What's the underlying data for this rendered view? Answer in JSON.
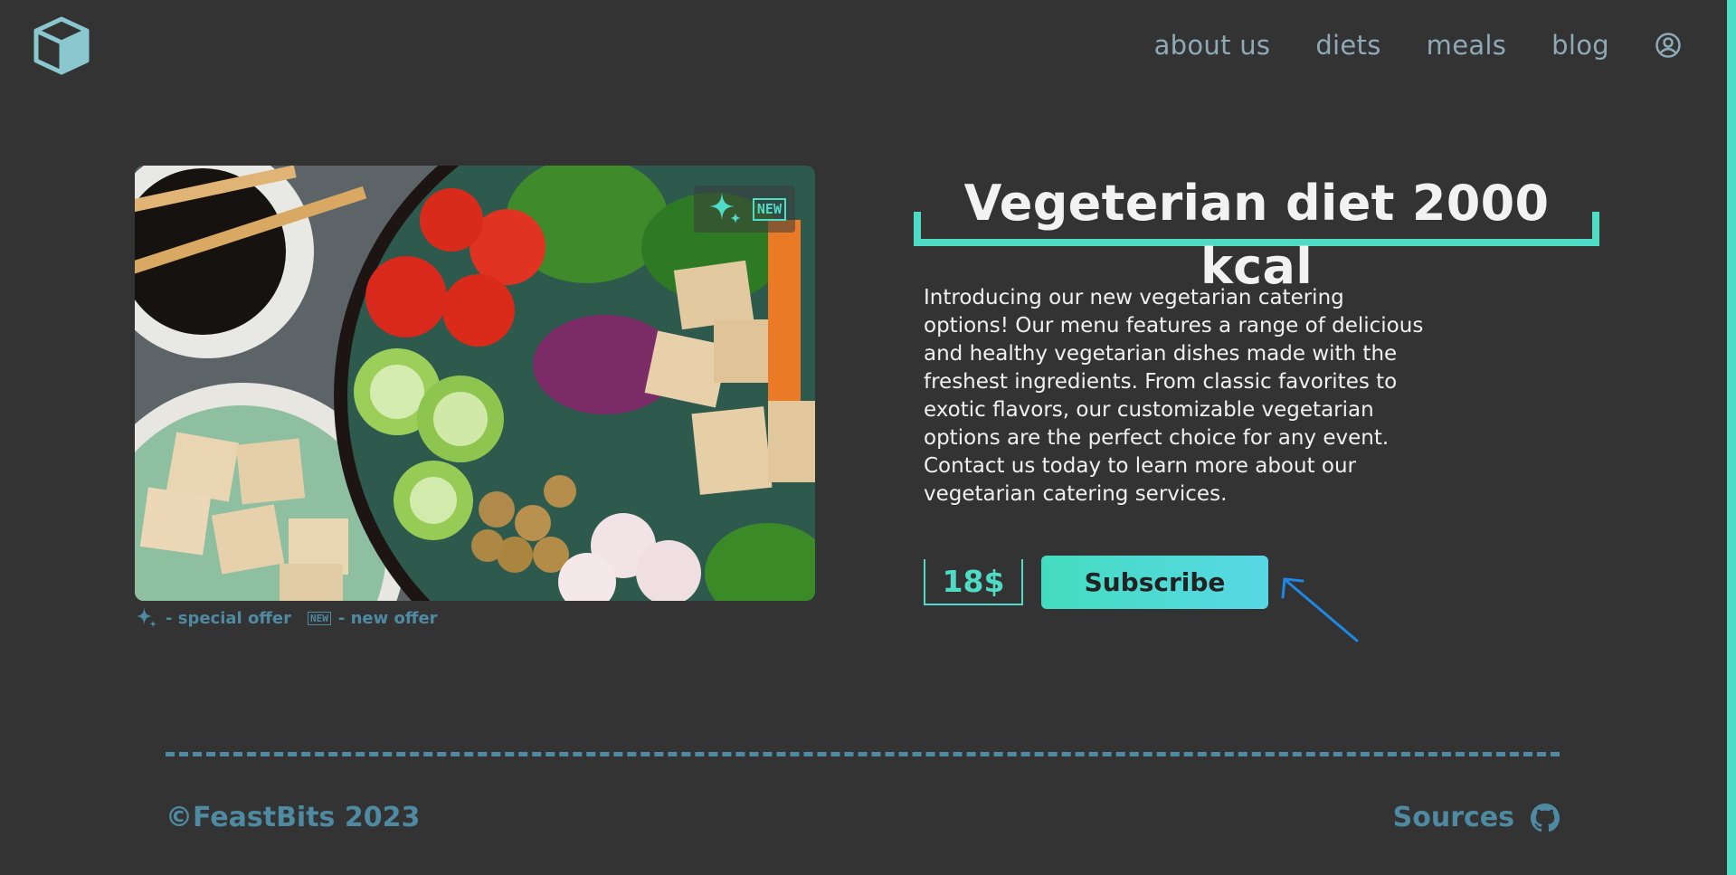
{
  "header": {
    "logo_icon": "cube-icon",
    "nav": [
      {
        "label": "about us"
      },
      {
        "label": "diets"
      },
      {
        "label": "meals"
      },
      {
        "label": "blog"
      }
    ],
    "user_icon": "user-circle-icon"
  },
  "product": {
    "image_alt": "vegetarian bowl",
    "badges": {
      "special_icon": "sparkle-icon",
      "new_label": "NEW"
    },
    "legend": {
      "special_text": "- special offer",
      "new_label": "NEW",
      "new_text": "- new offer"
    },
    "title": "Vegeterian diet 2000 kcal",
    "description": "Introducing our new vegetarian catering options! Our menu features a range of delicious and healthy vegetarian dishes made with the freshest ingredients. From classic favorites to exotic flavors, our customizable vegetarian options are the perfect choice for any event. Contact us today to learn more about our vegetarian catering services.",
    "price": "18$",
    "subscribe_label": "Subscribe"
  },
  "footer": {
    "copyright": "©FeastBits 2023",
    "sources_label": "Sources",
    "sources_icon": "github-icon"
  },
  "colors": {
    "background": "#333333",
    "accent": "#4fdcc6",
    "muted": "#4e8aa1",
    "nav": "#8eaab7"
  }
}
